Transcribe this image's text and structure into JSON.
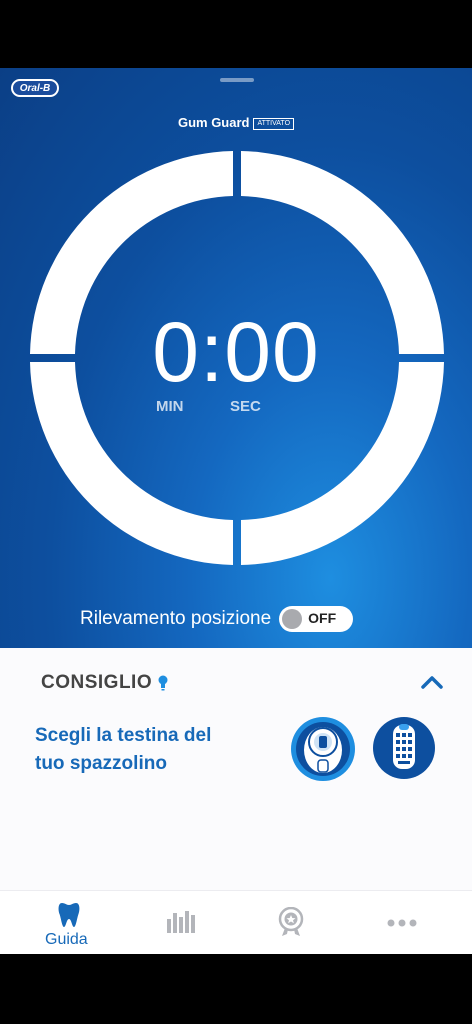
{
  "brand": {
    "logo_text": "Oral-B"
  },
  "header": {
    "gum_guard_label": "Gum Guard",
    "gum_guard_status": "ATTIVATO"
  },
  "timer": {
    "display": "0:00",
    "min_label": "MIN",
    "sec_label": "SEC"
  },
  "position_detection": {
    "label": "Rilevamento posizione",
    "toggle_state": "OFF"
  },
  "tip": {
    "title": "CONSIGLIO",
    "text_line1": "Scegli la testina del",
    "text_line2": "tuo spazzolino"
  },
  "tabbar": {
    "tabs": [
      {
        "label": "Guida",
        "icon": "tooth-icon",
        "active": true
      },
      {
        "label": "",
        "icon": "bar-chart-icon",
        "active": false
      },
      {
        "label": "",
        "icon": "award-icon",
        "active": false
      },
      {
        "label": "",
        "icon": "more-icon",
        "active": false
      }
    ]
  },
  "colors": {
    "hero_dark": "#0b3f86",
    "hero_light": "#1e8ee0",
    "accent": "#1769b8",
    "tip_title": "#444444"
  }
}
